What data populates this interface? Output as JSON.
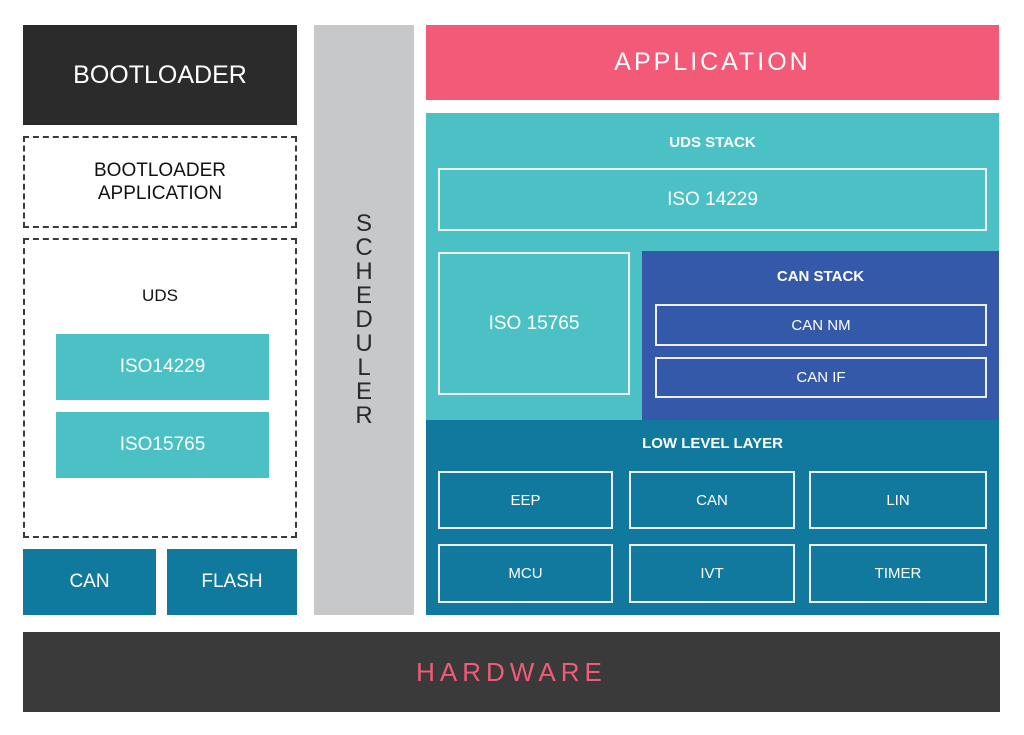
{
  "bootloader": {
    "title": "BOOTLOADER",
    "application_label": "BOOTLOADER APPLICATION",
    "uds": {
      "label": "UDS",
      "blocks": [
        "ISO14229",
        "ISO15765"
      ]
    },
    "drivers": [
      "CAN",
      "FLASH"
    ]
  },
  "scheduler": {
    "label": "SCHEDULER"
  },
  "application": {
    "label": "APPLICATION"
  },
  "uds_stack": {
    "label": "UDS STACK",
    "iso14229": "ISO 14229",
    "iso15765": "ISO 15765"
  },
  "can_stack": {
    "label": "CAN STACK",
    "items": [
      "CAN NM",
      "CAN IF"
    ]
  },
  "low_level_layer": {
    "label": "LOW LEVEL LAYER",
    "modules": [
      "EEP",
      "CAN",
      "LIN",
      "MCU",
      "IVT",
      "TIMER"
    ]
  },
  "hardware": {
    "label": "HARDWARE"
  },
  "colors": {
    "dark": "#2b2b2b",
    "teal": "#4bc1c6",
    "blue": "#3459a8",
    "dark_teal": "#10799d",
    "pink": "#f25a78",
    "gray": "#c7c8ca"
  }
}
